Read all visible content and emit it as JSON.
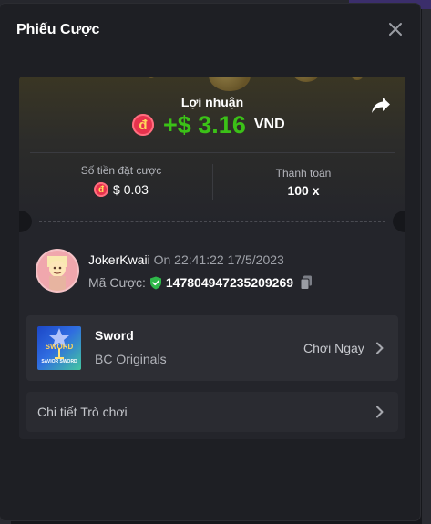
{
  "modal": {
    "title": "Phiếu Cược"
  },
  "profit": {
    "label": "Lợi nhuận",
    "currency_icon": "đ",
    "amount": "+$ 3.16",
    "unit": "VND"
  },
  "bet": {
    "amount_label": "Số tiền đặt cược",
    "amount_value": "$ 0.03",
    "payout_label": "Thanh toán",
    "payout_value": "100 x"
  },
  "player": {
    "name": "JokerKwaii",
    "time": "On 22:41:22 17/5/2023",
    "bet_id_label": "Mã Cược:",
    "bet_id": "147804947235209269"
  },
  "game": {
    "name": "Sword",
    "provider": "BC Originals",
    "play_label": "Chơi Ngay",
    "thumb_title": "SWORD",
    "thumb_sub": "SAVIOR SWORD"
  },
  "details": {
    "label": "Chi tiết Trò chơi"
  },
  "colors": {
    "accent_green": "#3bc117",
    "dong_red": "#e8324d",
    "shield_green": "#2fb84a"
  }
}
